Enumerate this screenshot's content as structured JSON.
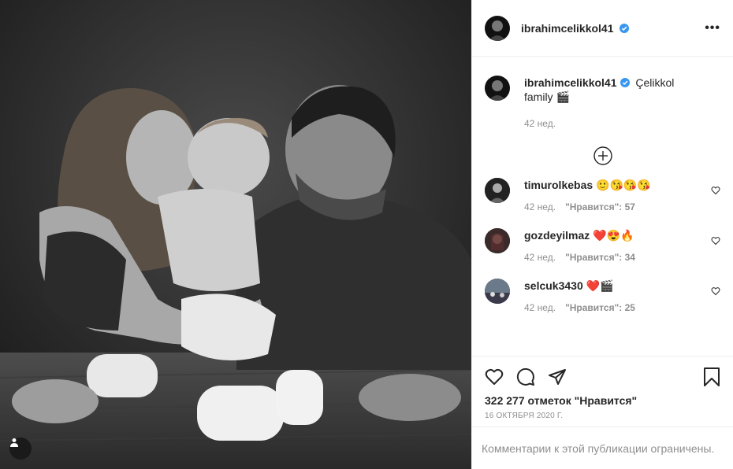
{
  "post": {
    "author": "ibrahimcelikkol41",
    "more_label": "•••",
    "caption_text": "Çelikkol family 🎬",
    "caption_time": "42 нед.",
    "like_count": "322 277 отметок \"Нравится\"",
    "date": "16 ОКТЯБРЯ 2020 Г.",
    "comments_limited": "Комментарии к этой публикации ограничены."
  },
  "comments": [
    {
      "user": "timurolkebas",
      "text": "🙂😘😘😘",
      "time": "42 нед.",
      "likes": "\"Нравится\": 57"
    },
    {
      "user": "gozdeyilmaz",
      "text": "❤️😍🔥",
      "time": "42 нед.",
      "likes": "\"Нравится\": 34"
    },
    {
      "user": "selcuk3430",
      "text": "❤️🎬",
      "time": "42 нед.",
      "likes": "\"Нравится\": 25"
    }
  ],
  "icons": {
    "verified": "verified-badge-icon",
    "like": "heart-icon",
    "comment": "comment-icon",
    "share": "paper-plane-icon",
    "save": "bookmark-icon",
    "load_more": "plus-circle-icon",
    "tagged": "user-tag-icon"
  },
  "colors": {
    "verified": "#3897f0",
    "muted": "#8e8e8e",
    "border": "#efefef",
    "heart": "#ed4956"
  }
}
